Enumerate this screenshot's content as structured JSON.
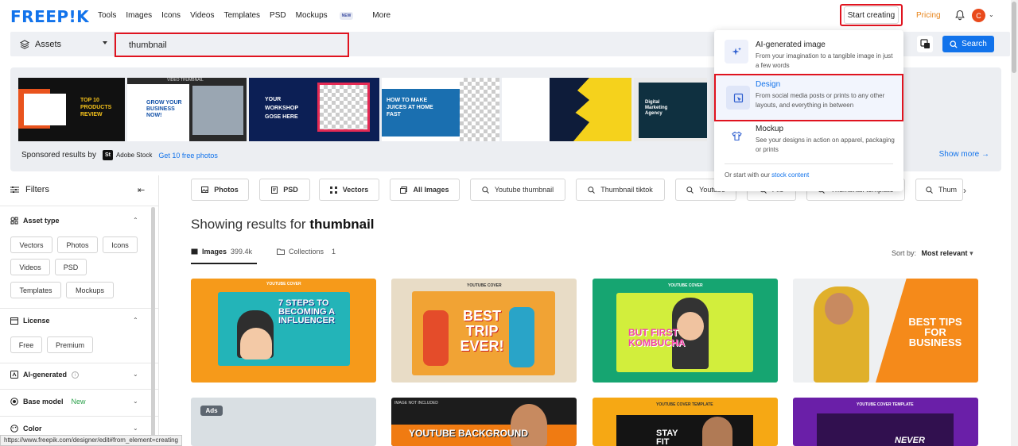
{
  "topnav": {
    "logo": "FREEP!K",
    "items": [
      "Tools",
      "Images",
      "Icons",
      "Videos",
      "Templates",
      "PSD",
      "Mockups",
      "More"
    ],
    "mockups_badge": "NEW",
    "start_creating": "Start creating",
    "pricing": "Pricing",
    "avatar_initial": "C"
  },
  "search": {
    "category": "Assets",
    "query": "thumbnail",
    "button": "Search"
  },
  "sponsored": {
    "label": "Sponsored results by",
    "provider": "Adobe Stock",
    "provider_icon": "St",
    "free_link": "Get 10 free photos",
    "show_more": "Show more →",
    "thumb_texts": [
      "TOP 10 PRODUCTS REVIEW",
      "GROW YOUR BUSINESS NOW!",
      "YOUR WORKSHOP GOSE HERE",
      "HOW TO MAKE JUICES AT HOME FAST",
      "Digital Marketing Agency",
      "VIDEO THUMBNAIL"
    ]
  },
  "dropdown": {
    "items": [
      {
        "title": "AI-generated image",
        "desc": "From your imagination to a tangible image in just a few words",
        "icon": "sparkle-icon"
      },
      {
        "title": "Design",
        "desc": "From social media posts or prints to any other layouts, and everything in between",
        "icon": "design-icon"
      },
      {
        "title": "Mockup",
        "desc": "See your designs in action on apparel, packaging or prints",
        "icon": "mockup-icon"
      }
    ],
    "footer_prefix": "Or start with our",
    "footer_link": "stock content"
  },
  "sidebar": {
    "title": "Filters",
    "asset_type": "Asset type",
    "asset_chips": [
      "Vectors",
      "Photos",
      "Icons",
      "Videos",
      "PSD",
      "Templates",
      "Mockups"
    ],
    "license": "License",
    "license_chips": [
      "Free",
      "Premium"
    ],
    "ai_generated": "AI-generated",
    "base_model": "Base model",
    "base_model_badge": "New",
    "color": "Color"
  },
  "tags": [
    "Photos",
    "PSD",
    "Vectors",
    "All Images",
    "Youtube thumbnail",
    "Thumbnail tiktok",
    "Youtube",
    "File",
    "Thumbnail template",
    "Thum"
  ],
  "results": {
    "prefix": "Showing results for",
    "query": "thumbnail",
    "tab_images": "Images",
    "tab_images_count": "399.4k",
    "tab_collections": "Collections",
    "tab_collections_count": "1",
    "sort_label": "Sort by:",
    "sort_value": "Most relevant",
    "ads_badge": "Ads"
  },
  "cards": {
    "c1_title": "YOUTUBE COVER",
    "c1_text": "7 STEPS TO BECOMING A INFLUENCER",
    "c2_title": "YOUTUBE COVER",
    "c2_text": "BEST TRIP EVER!",
    "c3_title": "YOUTUBE COVER",
    "c3_text": "BUT FIRST KOMBUCHA",
    "c4_text": "BEST TIPS FOR BUSINESS",
    "c6_title": "IMAGE NOT INCLUDED",
    "c6_text": "YOUTUBE BACKGROUND",
    "c7_title": "YOUTUBE COVER TEMPLATE",
    "c7_text": "STAY FIT",
    "c8_title": "YOUTUBE COVER TEMPLATE",
    "c8_text": "NEVER"
  },
  "statusbar": "https://www.freepik.com/designer/edit#from_element=creating"
}
